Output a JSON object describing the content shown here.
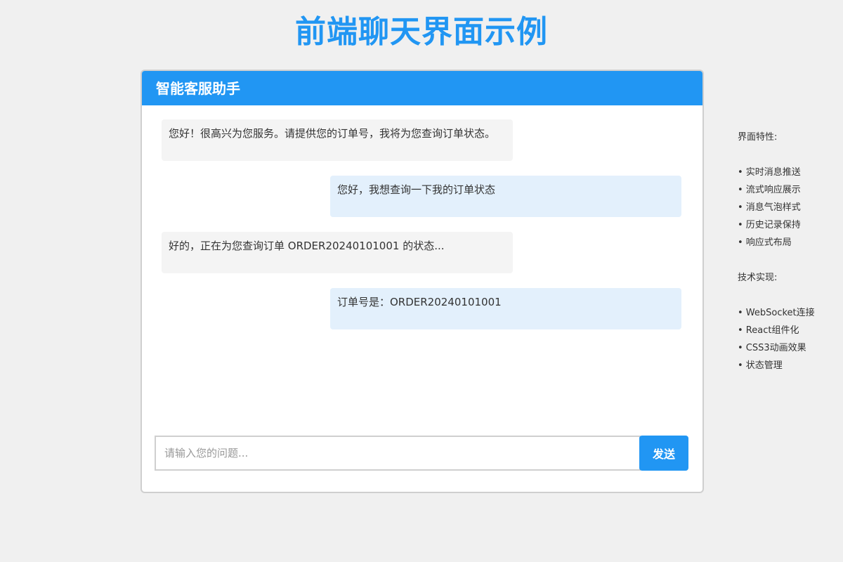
{
  "page": {
    "title": "前端聊天界面示例"
  },
  "chat": {
    "header_title": "智能客服助手",
    "messages": [
      {
        "role": "bot",
        "text": "您好！很高兴为您服务。请提供您的订单号，我将为您查询订单状态。"
      },
      {
        "role": "user",
        "text": "您好，我想查询一下我的订单状态"
      },
      {
        "role": "bot",
        "text": "好的，正在为您查询订单 ORDER20240101001 的状态..."
      },
      {
        "role": "user",
        "text": "订单号是：ORDER20240101001"
      }
    ],
    "input": {
      "value": "",
      "placeholder": "请输入您的问题..."
    },
    "send_label": "发送"
  },
  "side_panel": {
    "features_title": "界面特性:",
    "features": [
      "• 实时消息推送",
      "• 流式响应展示",
      "• 消息气泡样式",
      "• 历史记录保持",
      "• 响应式布局"
    ],
    "tech_title": "技术实现:",
    "tech": [
      "• WebSocket连接",
      "• React组件化",
      "• CSS3动画效果",
      "• 状态管理"
    ]
  },
  "colors": {
    "accent": "#2196f3",
    "page_background": "#f0f0f0",
    "bot_bubble": "#f4f4f4",
    "user_bubble": "#e3f0fc"
  }
}
